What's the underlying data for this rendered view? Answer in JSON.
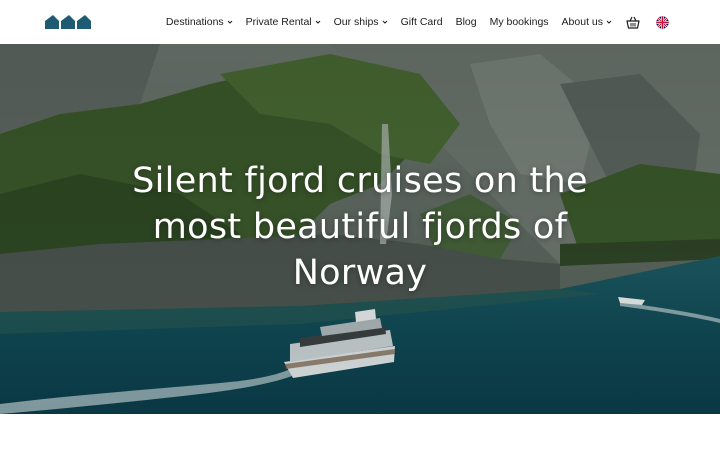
{
  "nav": {
    "items": [
      {
        "label": "Destinations",
        "has_dropdown": true
      },
      {
        "label": "Private Rental",
        "has_dropdown": true
      },
      {
        "label": "Our ships",
        "has_dropdown": true
      },
      {
        "label": "Gift Card",
        "has_dropdown": false
      },
      {
        "label": "Blog",
        "has_dropdown": false
      },
      {
        "label": "My bookings",
        "has_dropdown": false
      },
      {
        "label": "About us",
        "has_dropdown": true
      }
    ],
    "cart_icon": "basket-icon",
    "language_icon": "uk-flag-icon"
  },
  "hero": {
    "title": "Silent fjord cruises on the most beautiful fjords of Norway"
  },
  "colors": {
    "brand": "#1f5b73",
    "text": "#1c1c1c",
    "water": "#0f4a55",
    "cliff": "#5d6b63",
    "forest": "#3c5a2c"
  }
}
